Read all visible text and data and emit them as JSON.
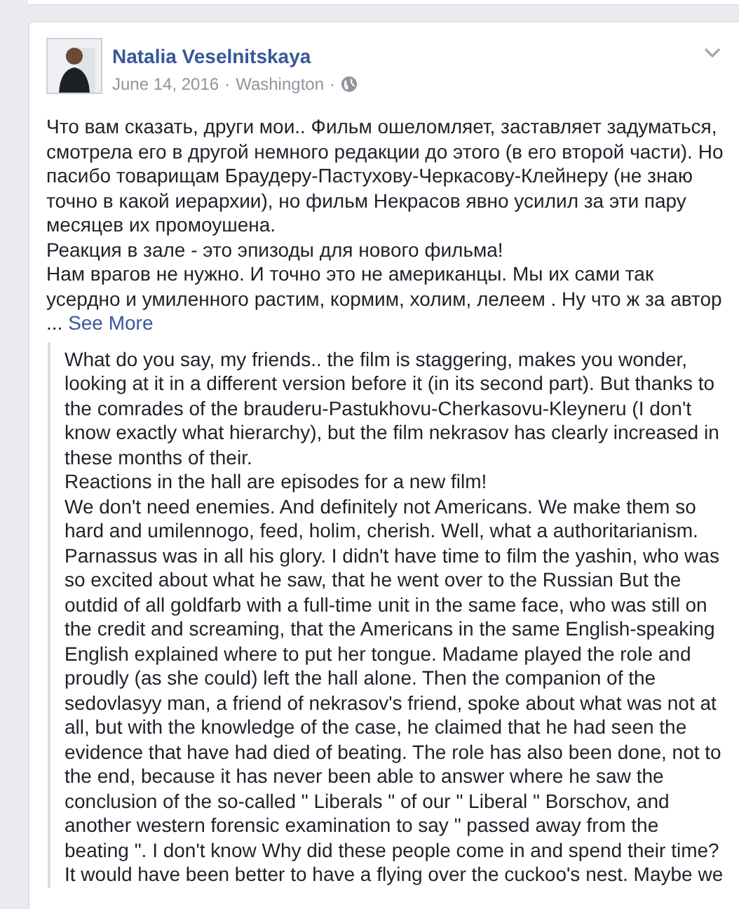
{
  "post": {
    "author": "Natalia Veselnitskaya",
    "date": "June 14, 2016",
    "separator_1": "·",
    "location": "Washington",
    "separator_2": "·",
    "paragraphs": [
      [
        "Что вам сказать, други мои.. Фильм ошеломляет, заставляет задуматься,",
        "смотрела его в другой немного редакции до этого (в его второй части). Но",
        "пасибо товарищам Браудеру-Пастухову-Черкасову-Клейнеру (не знаю",
        "точно в какой иерархии), но фильм Некрасов явно усилил за эти пару",
        "месяцев их промоушена."
      ],
      [
        "Реакция в зале - это эпизоды для нового фильма!"
      ],
      [
        "Нам врагов не нужно. И точно это не американцы. Мы их сами так",
        "усердно и умиленного растим, кормим, холим, лелеем . Ну что ж за автор"
      ]
    ],
    "ellipsis": "...",
    "see_more": "See More",
    "translation": [
      [
        "What do you say, my friends.. the film is staggering, makes you wonder,",
        "looking at it in a different version before it (in its second part). But thanks to",
        "the comrades of the brauderu-Pastukhovu-Cherkasovu-Kleyneru (I don't",
        "know exactly what hierarchy), but the film nekrasov has clearly increased in",
        "these months of their."
      ],
      [
        "Reactions in the hall are episodes for a new film!"
      ],
      [
        "We don't need enemies. And definitely not Americans. We make them so",
        "hard and umilennogo, feed, holim, cherish. Well, what a authoritarianism.",
        "Parnassus was in all his glory. I didn't have time to film the yashin, who was",
        "so excited about what he saw, that he went over to the Russian But the",
        "outdid of all goldfarb with a full-time unit in the same face, who was still on",
        "the credit and screaming, that the Americans in the same English-speaking",
        "English explained where to put her tongue. Madame played the role and",
        "proudly (as she could) left the hall alone. Then the companion of the",
        "sedovlasyy man, a friend of nekrasov's friend, spoke about what was not at",
        "all, but with the knowledge of the case, he claimed that he had seen the",
        "evidence that have had died of beating. The role has also been done, not to",
        "the end, because it has never been able to answer where he saw the",
        "conclusion of the so-called \" Liberals \" of our \" Liberal \" Borschov, and",
        "another western forensic examination to say \" passed away from the",
        "beating \". I don't know Why did these people come in and spend their time?",
        "It would have been better to have a flying over the cuckoo's nest. Maybe we"
      ]
    ]
  }
}
